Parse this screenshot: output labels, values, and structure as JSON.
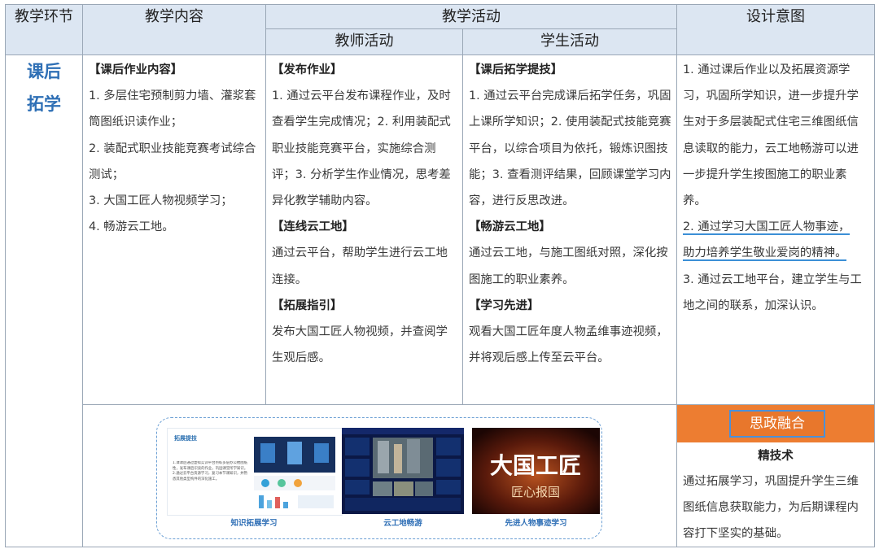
{
  "headers": {
    "stage": "教学环节",
    "content": "教学内容",
    "activity": "教学活动",
    "teacher": "教师活动",
    "student": "学生活动",
    "intent": "设计意图"
  },
  "stage": {
    "line1": "课后",
    "line2": "拓学"
  },
  "content": {
    "tag": "【课后作业内容】",
    "items": [
      "1. 多层住宅预制剪力墙、灌浆套筒图纸识读作业；",
      "2. 装配式职业技能竞赛考试综合测试；",
      "3. 大国工匠人物视频学习；",
      "4. 畅游云工地。"
    ]
  },
  "teacher": [
    {
      "tag": "【发布作业】",
      "text": "1. 通过云平台发布课程作业，及时查看学生完成情况；2. 利用装配式职业技能竞赛平台，实施综合测评；3. 分析学生作业情况，思考差异化教学辅助内容。"
    },
    {
      "tag": "【连线云工地】",
      "text": "通过云平台，帮助学生进行云工地连接。"
    },
    {
      "tag": "【拓展指引】",
      "text": "发布大国工匠人物视频，并查阅学生观后感。"
    }
  ],
  "student": [
    {
      "tag": "【课后拓学提技】",
      "text": "1. 通过云平台完成课后拓学任务，巩固上课所学知识；2. 使用装配式技能竞赛平台，以综合项目为依托，锻炼识图技能；3. 查看测评结果，回顾课堂学习内容，进行反思改进。"
    },
    {
      "tag": "【畅游云工地】",
      "text": "通过云工地，与施工图纸对照，深化按图施工的职业素养。"
    },
    {
      "tag": "【学习先进】",
      "text": "观看大国工匠年度人物孟维事迹视频，并将观后感上传至云平台。"
    }
  ],
  "intent": {
    "p1": "1. 通过课后作业以及拓展资源学习，巩固所学知识，进一步提升学生对于多层装配式住宅三维图纸信息读取的能力，云工地畅游可以进一步提升学生按图施工的职业素养。",
    "p2a": "2. 通过学习大国工匠人物事迹，",
    "p2b": "助力培养学生敬业爱岗的精神。",
    "p3": "3. 通过云工地平台，建立学生与工地之间的联系，加深认识。"
  },
  "images": {
    "cap1": "知识拓展学习",
    "cap2": "云工地畅游",
    "cap3": "先进人物事迹学习",
    "t1_title": "拓展提技",
    "t1_text": "1.课课后通过虚拟实训平台熟练多层办公楼图纸性，发布课后识读的作业，巩固课堂所学知识。2.通过云平台资源学习，复习本节课知识，并熟悉其他类型构件的深化施工。",
    "t3_title": "大国工匠",
    "t3_sub": "匠心报国"
  },
  "sizheng": {
    "label": "思政融合",
    "title": "精技术",
    "text": "通过拓展学习，巩固提升学生三维图纸信息获取能力，为后期课程内容打下坚实的基础。"
  }
}
